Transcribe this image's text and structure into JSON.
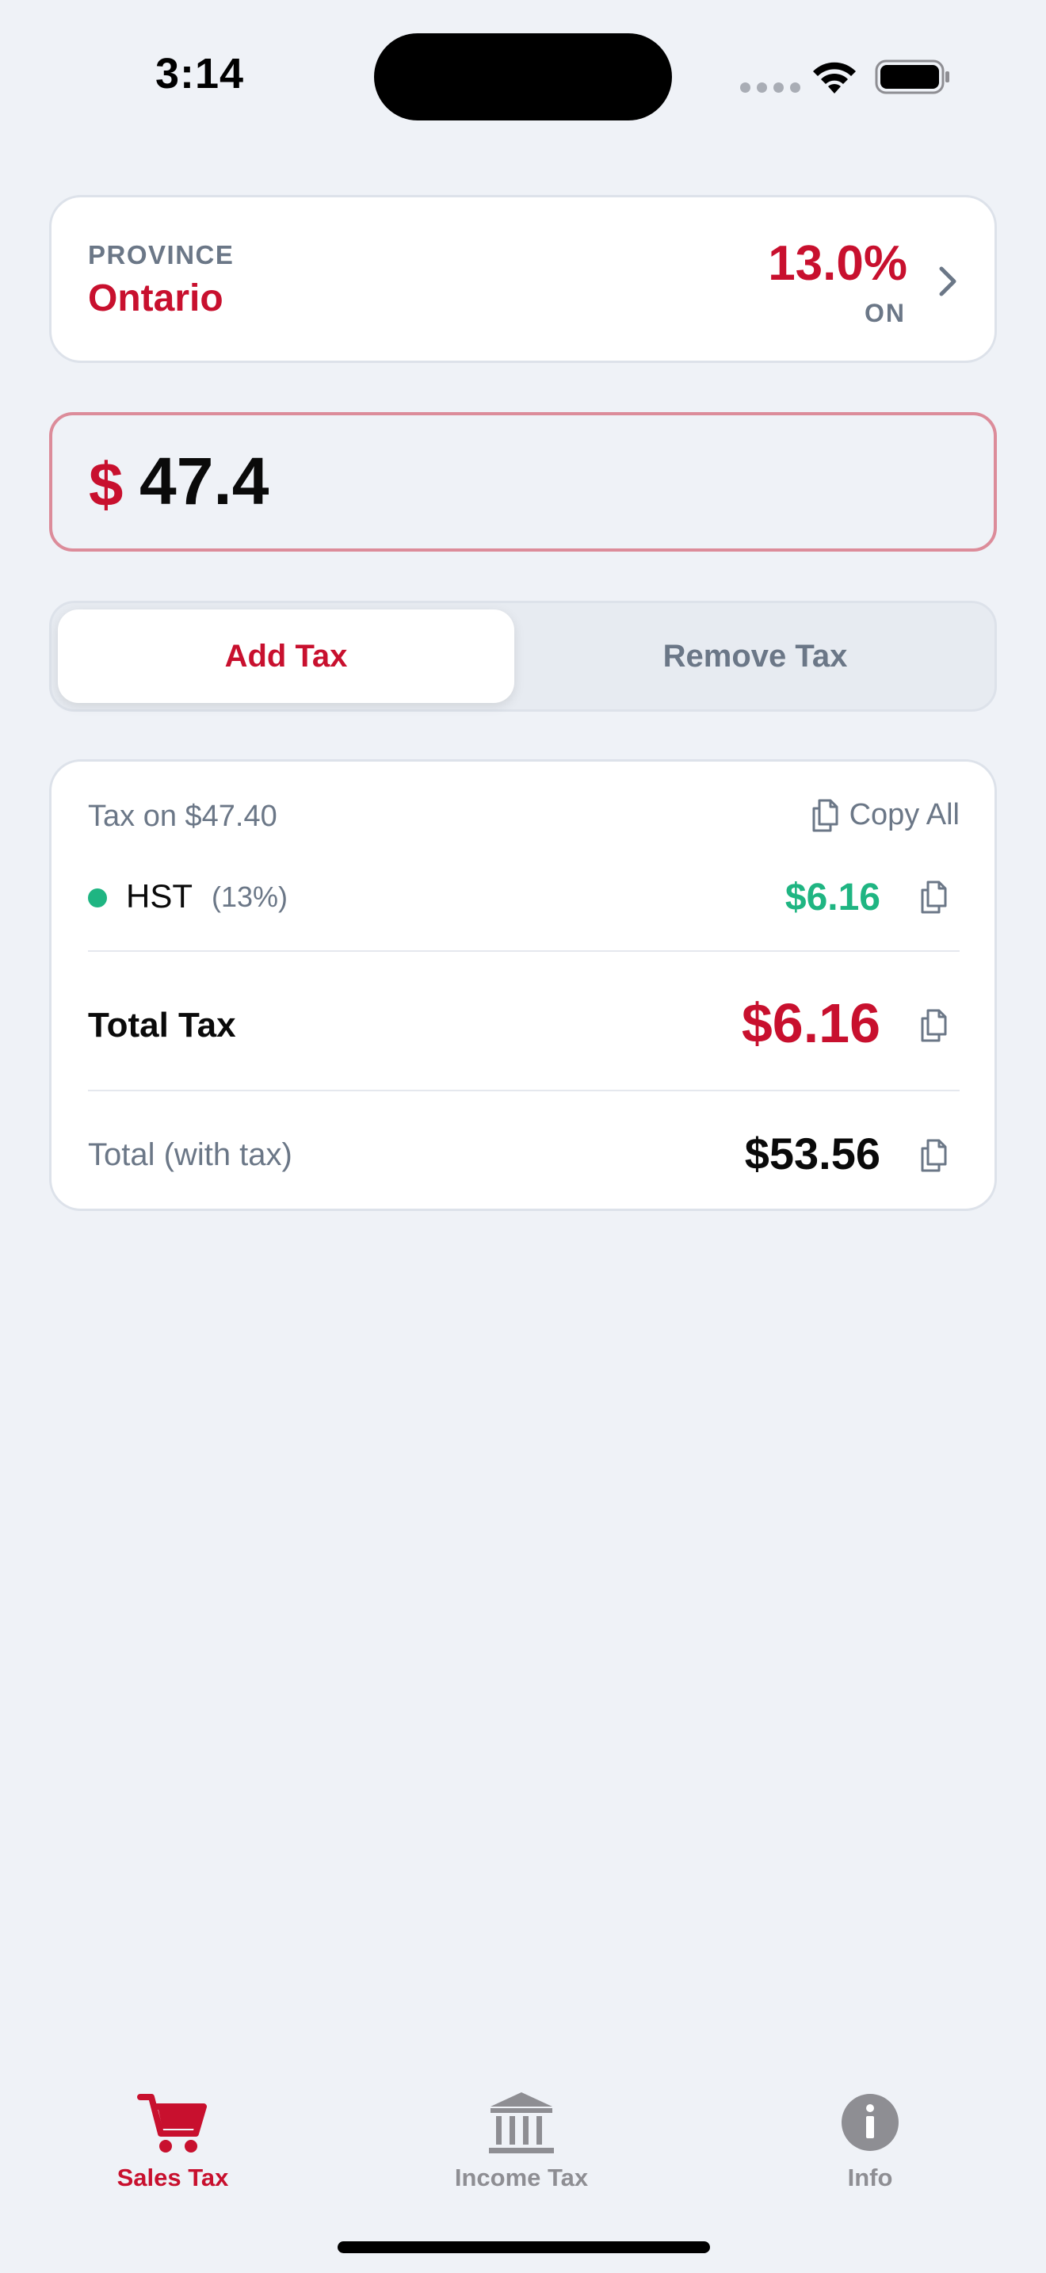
{
  "status_bar": {
    "time": "3:14"
  },
  "province": {
    "caption": "PROVINCE",
    "name": "Ontario",
    "rate": "13.0%",
    "code": "ON"
  },
  "amount": {
    "currency_symbol": "$",
    "value": "47.4"
  },
  "mode_toggle": {
    "options": [
      "Add Tax",
      "Remove Tax"
    ],
    "selected": "Add Tax"
  },
  "results": {
    "tax_on_label": "Tax on $47.40",
    "copy_all_label": "Copy All",
    "line_items": [
      {
        "name": "HST",
        "rate": "(13%)",
        "amount": "$6.16"
      }
    ],
    "total_tax_label": "Total Tax",
    "total_tax_amount": "$6.16",
    "total_label": "Total (with tax)",
    "total_amount": "$53.56"
  },
  "tabbar": {
    "items": [
      {
        "label": "Sales Tax",
        "icon": "cart-icon",
        "active": true
      },
      {
        "label": "Income Tax",
        "icon": "bank-icon",
        "active": false
      },
      {
        "label": "Info",
        "icon": "info-icon",
        "active": false
      }
    ]
  },
  "colors": {
    "accent": "#c8102e",
    "positive": "#1fb582",
    "muted": "#6b7787",
    "background": "#eff2f7"
  }
}
